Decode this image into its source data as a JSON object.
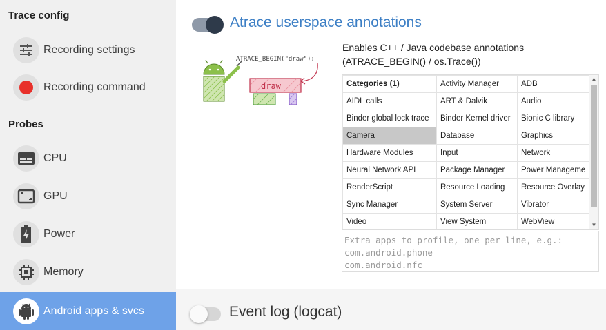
{
  "sidebar": {
    "trace_config_title": "Trace config",
    "trace_items": [
      {
        "label": "Recording settings",
        "icon": "tune-icon"
      },
      {
        "label": "Recording command",
        "icon": "record-icon"
      }
    ],
    "probes_title": "Probes",
    "probe_items": [
      {
        "label": "CPU",
        "icon": "cpu-icon"
      },
      {
        "label": "GPU",
        "icon": "gpu-icon"
      },
      {
        "label": "Power",
        "icon": "battery-icon"
      },
      {
        "label": "Memory",
        "icon": "memory-chip-icon"
      },
      {
        "label": "Android apps & svcs",
        "icon": "android-icon",
        "active": true
      }
    ]
  },
  "atrace": {
    "enabled": true,
    "title": "Atrace userspace annotations",
    "illustration_caption": "ATRACE_BEGIN(\"draw\");",
    "illustration_box": "draw",
    "description_line1": "Enables C++ / Java codebase annotations",
    "description_line2": "(ATRACE_BEGIN() / os.Trace())",
    "categories": [
      [
        "Categories (1)",
        "Activity Manager",
        "ADB"
      ],
      [
        "AIDL calls",
        "ART & Dalvik",
        "Audio"
      ],
      [
        "Binder global lock trace",
        "Binder Kernel driver",
        "Bionic C library"
      ],
      [
        "Camera",
        "Database",
        "Graphics"
      ],
      [
        "Hardware Modules",
        "Input",
        "Network"
      ],
      [
        "Neural Network API",
        "Package Manager",
        "Power Manageme"
      ],
      [
        "RenderScript",
        "Resource Loading",
        "Resource Overlay"
      ],
      [
        "Sync Manager",
        "System Server",
        "Vibrator"
      ],
      [
        "Video",
        "View System",
        "WebView"
      ]
    ],
    "selected_category": "Camera",
    "extra_apps_placeholder": "Extra apps to profile, one per line, e.g.:\ncom.android.phone\ncom.android.nfc"
  },
  "logcat": {
    "enabled": false,
    "title": "Event log (logcat)"
  },
  "colors": {
    "accent": "#2e3a4a",
    "sidebar_active": "#6ea2e8",
    "title_active": "#3d7fc5",
    "title_inactive": "#333333"
  }
}
